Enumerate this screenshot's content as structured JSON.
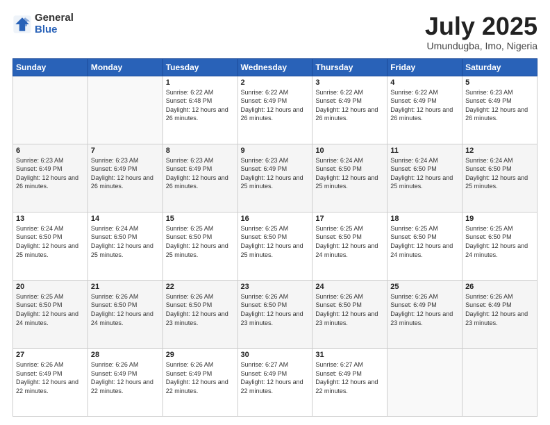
{
  "logo": {
    "general": "General",
    "blue": "Blue"
  },
  "header": {
    "month": "July 2025",
    "location": "Umundugba, Imo, Nigeria"
  },
  "weekdays": [
    "Sunday",
    "Monday",
    "Tuesday",
    "Wednesday",
    "Thursday",
    "Friday",
    "Saturday"
  ],
  "weeks": [
    [
      {
        "day": "",
        "info": ""
      },
      {
        "day": "",
        "info": ""
      },
      {
        "day": "1",
        "info": "Sunrise: 6:22 AM\nSunset: 6:48 PM\nDaylight: 12 hours and 26 minutes."
      },
      {
        "day": "2",
        "info": "Sunrise: 6:22 AM\nSunset: 6:49 PM\nDaylight: 12 hours and 26 minutes."
      },
      {
        "day": "3",
        "info": "Sunrise: 6:22 AM\nSunset: 6:49 PM\nDaylight: 12 hours and 26 minutes."
      },
      {
        "day": "4",
        "info": "Sunrise: 6:22 AM\nSunset: 6:49 PM\nDaylight: 12 hours and 26 minutes."
      },
      {
        "day": "5",
        "info": "Sunrise: 6:23 AM\nSunset: 6:49 PM\nDaylight: 12 hours and 26 minutes."
      }
    ],
    [
      {
        "day": "6",
        "info": "Sunrise: 6:23 AM\nSunset: 6:49 PM\nDaylight: 12 hours and 26 minutes."
      },
      {
        "day": "7",
        "info": "Sunrise: 6:23 AM\nSunset: 6:49 PM\nDaylight: 12 hours and 26 minutes."
      },
      {
        "day": "8",
        "info": "Sunrise: 6:23 AM\nSunset: 6:49 PM\nDaylight: 12 hours and 26 minutes."
      },
      {
        "day": "9",
        "info": "Sunrise: 6:23 AM\nSunset: 6:49 PM\nDaylight: 12 hours and 25 minutes."
      },
      {
        "day": "10",
        "info": "Sunrise: 6:24 AM\nSunset: 6:50 PM\nDaylight: 12 hours and 25 minutes."
      },
      {
        "day": "11",
        "info": "Sunrise: 6:24 AM\nSunset: 6:50 PM\nDaylight: 12 hours and 25 minutes."
      },
      {
        "day": "12",
        "info": "Sunrise: 6:24 AM\nSunset: 6:50 PM\nDaylight: 12 hours and 25 minutes."
      }
    ],
    [
      {
        "day": "13",
        "info": "Sunrise: 6:24 AM\nSunset: 6:50 PM\nDaylight: 12 hours and 25 minutes."
      },
      {
        "day": "14",
        "info": "Sunrise: 6:24 AM\nSunset: 6:50 PM\nDaylight: 12 hours and 25 minutes."
      },
      {
        "day": "15",
        "info": "Sunrise: 6:25 AM\nSunset: 6:50 PM\nDaylight: 12 hours and 25 minutes."
      },
      {
        "day": "16",
        "info": "Sunrise: 6:25 AM\nSunset: 6:50 PM\nDaylight: 12 hours and 25 minutes."
      },
      {
        "day": "17",
        "info": "Sunrise: 6:25 AM\nSunset: 6:50 PM\nDaylight: 12 hours and 24 minutes."
      },
      {
        "day": "18",
        "info": "Sunrise: 6:25 AM\nSunset: 6:50 PM\nDaylight: 12 hours and 24 minutes."
      },
      {
        "day": "19",
        "info": "Sunrise: 6:25 AM\nSunset: 6:50 PM\nDaylight: 12 hours and 24 minutes."
      }
    ],
    [
      {
        "day": "20",
        "info": "Sunrise: 6:25 AM\nSunset: 6:50 PM\nDaylight: 12 hours and 24 minutes."
      },
      {
        "day": "21",
        "info": "Sunrise: 6:26 AM\nSunset: 6:50 PM\nDaylight: 12 hours and 24 minutes."
      },
      {
        "day": "22",
        "info": "Sunrise: 6:26 AM\nSunset: 6:50 PM\nDaylight: 12 hours and 23 minutes."
      },
      {
        "day": "23",
        "info": "Sunrise: 6:26 AM\nSunset: 6:50 PM\nDaylight: 12 hours and 23 minutes."
      },
      {
        "day": "24",
        "info": "Sunrise: 6:26 AM\nSunset: 6:50 PM\nDaylight: 12 hours and 23 minutes."
      },
      {
        "day": "25",
        "info": "Sunrise: 6:26 AM\nSunset: 6:49 PM\nDaylight: 12 hours and 23 minutes."
      },
      {
        "day": "26",
        "info": "Sunrise: 6:26 AM\nSunset: 6:49 PM\nDaylight: 12 hours and 23 minutes."
      }
    ],
    [
      {
        "day": "27",
        "info": "Sunrise: 6:26 AM\nSunset: 6:49 PM\nDaylight: 12 hours and 22 minutes."
      },
      {
        "day": "28",
        "info": "Sunrise: 6:26 AM\nSunset: 6:49 PM\nDaylight: 12 hours and 22 minutes."
      },
      {
        "day": "29",
        "info": "Sunrise: 6:26 AM\nSunset: 6:49 PM\nDaylight: 12 hours and 22 minutes."
      },
      {
        "day": "30",
        "info": "Sunrise: 6:27 AM\nSunset: 6:49 PM\nDaylight: 12 hours and 22 minutes."
      },
      {
        "day": "31",
        "info": "Sunrise: 6:27 AM\nSunset: 6:49 PM\nDaylight: 12 hours and 22 minutes."
      },
      {
        "day": "",
        "info": ""
      },
      {
        "day": "",
        "info": ""
      }
    ]
  ]
}
